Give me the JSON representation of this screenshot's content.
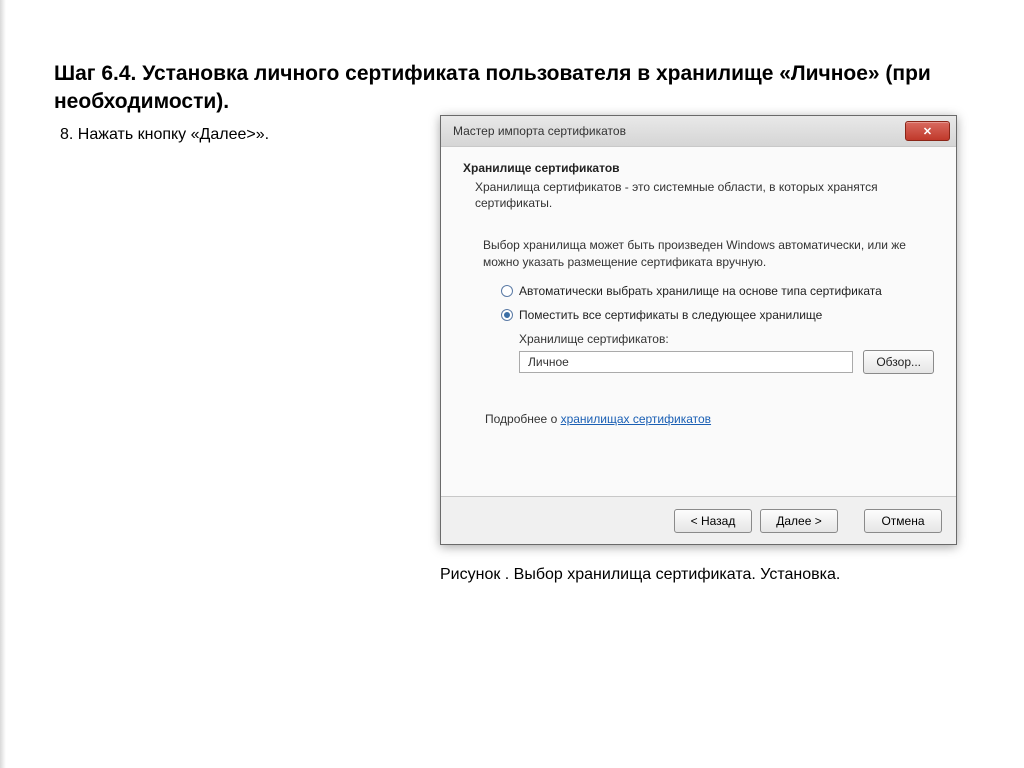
{
  "page": {
    "title": "Шаг 6.4. Установка личного сертификата пользователя в хранилище «Личное» (при необходимости).",
    "instruction": "8. Нажать кнопку «Далее>».",
    "caption": "Рисунок . Выбор хранилища сертификата. Установка."
  },
  "wizard": {
    "title": "Мастер импорта сертификатов",
    "close_glyph": "✕",
    "section_title": "Хранилище сертификатов",
    "section_desc": "Хранилища сертификатов - это системные области, в которых хранятся сертификаты.",
    "body_text": "Выбор хранилища может быть произведен Windows автоматически, или же можно указать размещение сертификата вручную.",
    "radio_auto": "Автоматически выбрать хранилище на основе типа сертификата",
    "radio_manual": "Поместить все сертификаты в следующее хранилище",
    "store_label": "Хранилище сертификатов:",
    "store_value": "Личное",
    "browse_label": "Обзор...",
    "more_prefix": "Подробнее о ",
    "more_link": "хранилищах сертификатов",
    "btn_back": "< Назад",
    "btn_next": "Далее >",
    "btn_cancel": "Отмена"
  }
}
